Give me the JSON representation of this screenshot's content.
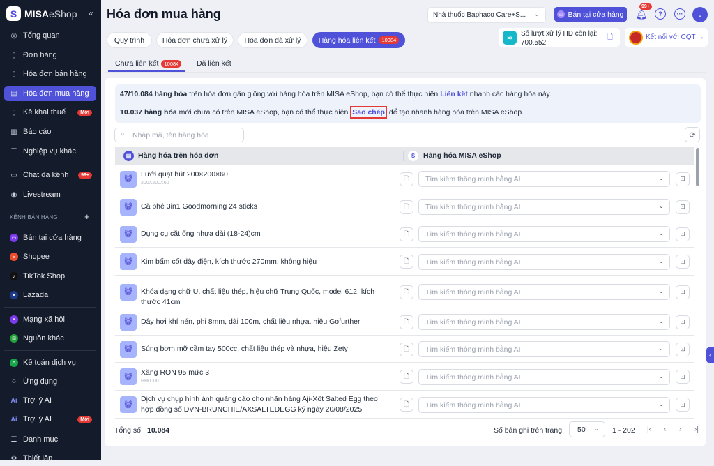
{
  "sidebar": {
    "brand": "MISA",
    "brand2": "eShop",
    "items": [
      {
        "label": "Tổng quan",
        "icon": "dashboard-icon"
      },
      {
        "label": "Đơn hàng",
        "icon": "order-icon"
      },
      {
        "label": "Hóa đơn bán hàng",
        "icon": "invoice-icon"
      },
      {
        "label": "Hóa đơn mua hàng",
        "icon": "purchase-invoice-icon",
        "active": true
      },
      {
        "label": "Kê khai thuế",
        "icon": "tax-icon",
        "badge": "Mới"
      },
      {
        "label": "Báo cáo",
        "icon": "report-icon"
      },
      {
        "label": "Nghiệp vụ khác",
        "icon": "list-icon"
      },
      {
        "label": "Chat đa kênh",
        "icon": "chat-icon",
        "badge": "99+"
      },
      {
        "label": "Livestream",
        "icon": "livestream-icon"
      },
      {
        "label": "Bán tại cửa hàng",
        "icon": "store-icon"
      },
      {
        "label": "Shopee",
        "icon": "shopee-icon"
      },
      {
        "label": "TikTok Shop",
        "icon": "tiktok-icon"
      },
      {
        "label": "Lazada",
        "icon": "lazada-icon"
      },
      {
        "label": "Mạng xã hội",
        "icon": "social-icon"
      },
      {
        "label": "Nguồn khác",
        "icon": "cart-icon"
      },
      {
        "label": "Kế toán dịch vụ",
        "icon": "accounting-icon"
      },
      {
        "label": "Ứng dụng",
        "icon": "apps-icon"
      },
      {
        "label": "Trợ lý AI",
        "icon": "ai-icon"
      },
      {
        "label": "Trợ lý AI",
        "icon": "ai-icon",
        "badge": "Mới"
      },
      {
        "label": "Danh mục",
        "icon": "menu-icon"
      },
      {
        "label": "Thiết lập",
        "icon": "settings-icon"
      }
    ],
    "section_header": "KÊNH BÁN HÀNG"
  },
  "header": {
    "title": "Hóa đơn mua hàng",
    "store": "Nhà thuốc Baphaco Care+S...",
    "pos_button": "Bán tại cửa hàng",
    "notif_badge": "99+",
    "quota_label": "Số lượt xử lý HĐ còn lại:",
    "quota_value": "700.552",
    "cqt": "Kết nối với CQT →"
  },
  "tabs": [
    {
      "label": "Quy trình"
    },
    {
      "label": "Hóa đơn chưa xử lý"
    },
    {
      "label": "Hóa đơn đã xử lý"
    },
    {
      "label": "Hàng hóa liên kết",
      "badge": "10084"
    }
  ],
  "subtabs": [
    {
      "label": "Chưa liên kết",
      "badge": "10084"
    },
    {
      "label": "Đã liên kết"
    }
  ],
  "info": {
    "l1_bold": "47/10.084 hàng hóa",
    "l1_text": " trên hóa đơn gần giống với hàng hóa trên MISA eShop, bạn có thể thực hiện ",
    "l1_link": "Liên kết",
    "l1_end": " nhanh các hàng hóa này.",
    "l2_bold": "10.037 hàng hóa",
    "l2_text": " mới chưa có trên MISA eShop, bạn có thể thực hiện ",
    "l2_link": "Sao chép",
    "l2_end": " để tạo nhanh hàng hóa trên MISA eShop."
  },
  "search_placeholder": "Nhập mã, tên hàng hóa",
  "table": {
    "col1": "Hàng hóa trên hóa đơn",
    "col2": "Hàng hóa MISA eShop",
    "select_placeholder": "Tìm kiếm thông minh bằng AI",
    "rows": [
      {
        "name": "Lưới quạt hút 200×200×60",
        "code": "200X200X60"
      },
      {
        "name": "Cà phê 3in1 Goodmorning 24 sticks"
      },
      {
        "name": "Dụng cụ cắt ống nhựa dài (18-24)cm"
      },
      {
        "name": "Kim bấm cốt dây điện, kích thước 270mm, không hiệu"
      },
      {
        "name": "Khóa dạng chữ U, chất liệu thép, hiệu chữ Trung Quốc, model 612, kích thước 41cm"
      },
      {
        "name": "Dây hơi khí nén, phi 8mm, dài 100m, chất liệu nhựa, hiệu Gofurther"
      },
      {
        "name": "Súng bơm mỡ cầm tay 500cc, chất liệu thép và nhựa, hiệu Zety"
      },
      {
        "name": "Xăng RON 95 mức 3",
        "code": "HH00001"
      },
      {
        "name": "Dịch vụ chụp hình ảnh quảng cáo cho nhãn hàng Aji-Xốt Salted Egg theo hợp đồng số DVN-BRUNCHIE/AXSALTEDEGG ký ngày 20/08/2025"
      }
    ]
  },
  "footer": {
    "total_label": "Tổng số:",
    "total": "10.084",
    "per_page_label": "Số bản ghi trên trang",
    "per_page": "50",
    "range": "1 - 202"
  }
}
